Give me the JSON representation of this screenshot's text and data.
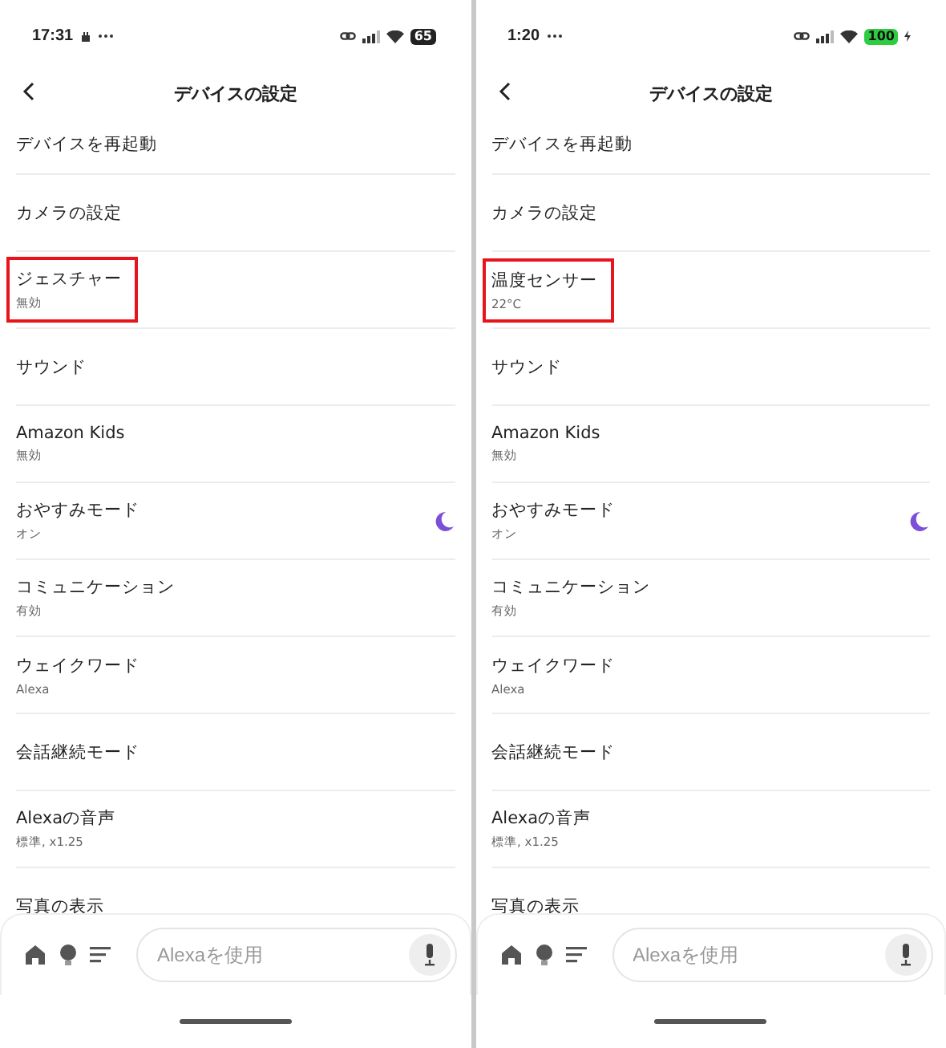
{
  "phones": [
    {
      "status_bar": {
        "time": "17:31",
        "notification_icon": true,
        "battery": "65",
        "charging": false
      },
      "header": {
        "title": "デバイスの設定"
      },
      "items": [
        {
          "title": "デバイスを再起動",
          "highlighted": false,
          "moon": false
        },
        {
          "title": "カメラの設定",
          "highlighted": false,
          "moon": false
        },
        {
          "title": "ジェスチャー",
          "subtitle": "無効",
          "highlighted": true,
          "moon": false
        },
        {
          "title": "サウンド",
          "highlighted": false,
          "moon": false
        },
        {
          "title": "Amazon Kids",
          "subtitle": "無効",
          "highlighted": false,
          "moon": false
        },
        {
          "title": "おやすみモード",
          "subtitle": "オン",
          "highlighted": false,
          "moon": true
        },
        {
          "title": "コミュニケーション",
          "subtitle": "有効",
          "highlighted": false,
          "moon": false
        },
        {
          "title": "ウェイクワード",
          "subtitle": "Alexa",
          "highlighted": false,
          "moon": false
        },
        {
          "title": "会話継続モード",
          "highlighted": false,
          "moon": false
        },
        {
          "title": "Alexaの音声",
          "subtitle": "標準, x1.25",
          "highlighted": false,
          "moon": false
        },
        {
          "title": "写真の表示",
          "highlighted": false,
          "moon": false
        }
      ],
      "search": {
        "placeholder": "Alexaを使用"
      }
    },
    {
      "status_bar": {
        "time": "1:20",
        "notification_icon": false,
        "battery": "100",
        "charging": true
      },
      "header": {
        "title": "デバイスの設定"
      },
      "items": [
        {
          "title": "デバイスを再起動",
          "highlighted": false,
          "moon": false
        },
        {
          "title": "カメラの設定",
          "highlighted": false,
          "moon": false
        },
        {
          "title": "温度センサー",
          "subtitle": "22°C",
          "highlighted": true,
          "moon": false
        },
        {
          "title": "サウンド",
          "highlighted": false,
          "moon": false
        },
        {
          "title": "Amazon Kids",
          "subtitle": "無効",
          "highlighted": false,
          "moon": false
        },
        {
          "title": "おやすみモード",
          "subtitle": "オン",
          "highlighted": false,
          "moon": true
        },
        {
          "title": "コミュニケーション",
          "subtitle": "有効",
          "highlighted": false,
          "moon": false
        },
        {
          "title": "ウェイクワード",
          "subtitle": "Alexa",
          "highlighted": false,
          "moon": false
        },
        {
          "title": "会話継続モード",
          "highlighted": false,
          "moon": false
        },
        {
          "title": "Alexaの音声",
          "subtitle": "標準, x1.25",
          "highlighted": false,
          "moon": false
        },
        {
          "title": "写真の表示",
          "highlighted": false,
          "moon": false
        }
      ],
      "search": {
        "placeholder": "Alexaを使用"
      }
    }
  ]
}
